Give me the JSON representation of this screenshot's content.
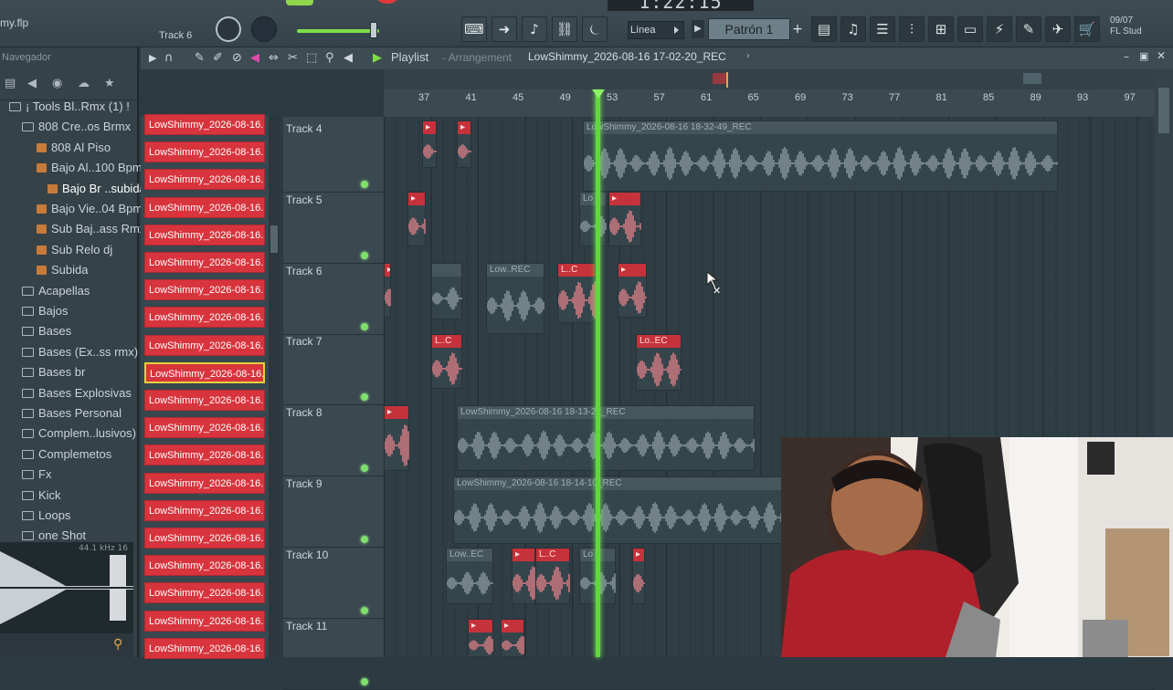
{
  "toolbar": {
    "file_name": "my.flp",
    "hint": "Track 6",
    "time": "1:22:15",
    "snap": "Línea",
    "pattern": "Patrón 1",
    "date_line1": "09/07",
    "date_line2": "FL Stud"
  },
  "browser": {
    "header": "Navegador",
    "items": [
      {
        "label": "¡ Tools Bl..Rmx (1) !",
        "type": "folder"
      },
      {
        "label": "808 Cre..os Brmx",
        "type": "folder"
      },
      {
        "label": "808 Al Piso",
        "type": "file"
      },
      {
        "label": "Bajo Al..100 Bpm",
        "type": "file"
      },
      {
        "label": "Bajo Br ..subida",
        "type": "file"
      },
      {
        "label": "Bajo Vie..04 Bpm",
        "type": "file"
      },
      {
        "label": "Sub Baj..ass Rmx",
        "type": "file"
      },
      {
        "label": "Sub Relo dj",
        "type": "file"
      },
      {
        "label": "Subida",
        "type": "file"
      },
      {
        "label": "Acapellas",
        "type": "folder"
      },
      {
        "label": "Bajos",
        "type": "folder"
      },
      {
        "label": "Bases",
        "type": "folder"
      },
      {
        "label": "Bases (Ex..ss rmx)",
        "type": "folder"
      },
      {
        "label": "Bases br",
        "type": "folder"
      },
      {
        "label": "Bases Explosivas",
        "type": "folder"
      },
      {
        "label": "Bases Personal",
        "type": "folder"
      },
      {
        "label": "Complem..lusivos)",
        "type": "folder"
      },
      {
        "label": "Complemetos",
        "type": "folder"
      },
      {
        "label": "Fx",
        "type": "folder"
      },
      {
        "label": "Kick",
        "type": "folder"
      },
      {
        "label": "Loops",
        "type": "folder"
      },
      {
        "label": "one Shot",
        "type": "folder"
      }
    ],
    "preview_info": "44.1 kHz 16"
  },
  "picker": {
    "items": [
      "LowShimmy_2026-08-16...",
      "LowShimmy_2026-08-16...",
      "LowShimmy_2026-08-16...",
      "LowShimmy_2026-08-16...",
      "LowShimmy_2026-08-16...",
      "LowShimmy_2026-08-16...",
      "LowShimmy_2026-08-16...",
      "LowShimmy_2026-08-16...",
      "LowShimmy_2026-08-16...",
      "LowShimmy_2026-08-16...",
      "LowShimmy_2026-08-16...",
      "LowShimmy_2026-08-16...",
      "LowShimmy_2026-08-16...",
      "LowShimmy_2026-08-16...",
      "LowShimmy_2026-08-16...",
      "LowShimmy_2026-08-16...",
      "LowShimmy_2026-08-16...",
      "LowShimmy_2026-08-16...",
      "LowShimmy_2026-08-16...",
      "LowShimmy_2026-08-16..."
    ],
    "selected_index": 9
  },
  "playlist": {
    "title": "Playlist",
    "subtitle": "- Arrangement",
    "file": "LowShimmy_2026-08-16 17-02-20_REC",
    "bars": [
      "37",
      "41",
      "45",
      "49",
      "53",
      "57",
      "61",
      "65",
      "69",
      "73",
      "77",
      "81",
      "85",
      "89",
      "93",
      "97"
    ],
    "tracks": [
      "Track 4",
      "Track 5",
      "Track 6",
      "Track 7",
      "Track 8",
      "Track 9",
      "Track 10",
      "Track 11"
    ],
    "clip_labels": {
      "t4_main": "LowShimmy_2026-08-16 18-32-49_REC",
      "t5_a": "Lo",
      "t6_a": "Low..REC",
      "t6_b": "L..C",
      "t7_a": "L..C",
      "t7_b": "Lo..EC",
      "t8_main": "LowShimmy_2026-08-16 18-13-22_REC",
      "t9_main": "LowShimmy_2026-08-16 18-14-10_REC",
      "t10_a": "Low..EC",
      "t10_b": "L..C",
      "t10_c": "Lo"
    }
  },
  "colors": {
    "accent_red": "#d8343d",
    "playhead": "#5fd83c",
    "background": "#2f3d44"
  }
}
